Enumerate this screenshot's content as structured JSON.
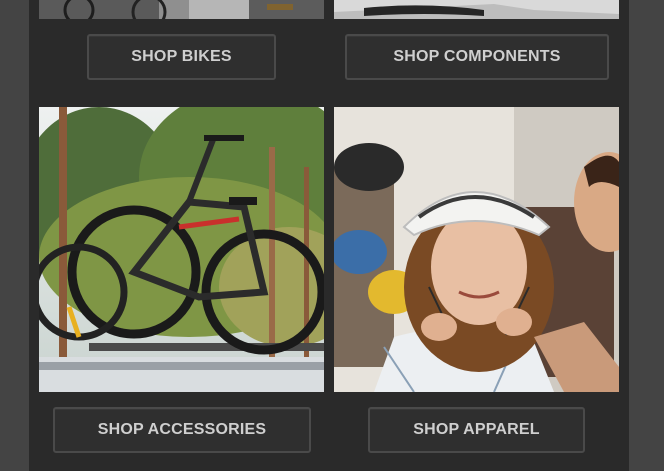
{
  "buttons": {
    "bikes": "SHOP BIKES",
    "components": "SHOP COMPONENTS",
    "accessories": "SHOP ACCESSORIES",
    "apparel": "SHOP APPAREL"
  },
  "colors": {
    "page_bg": "#444444",
    "panel_bg": "#2a2a2a",
    "button_text": "#cfcfcf",
    "button_border": "#4a4a4a"
  }
}
